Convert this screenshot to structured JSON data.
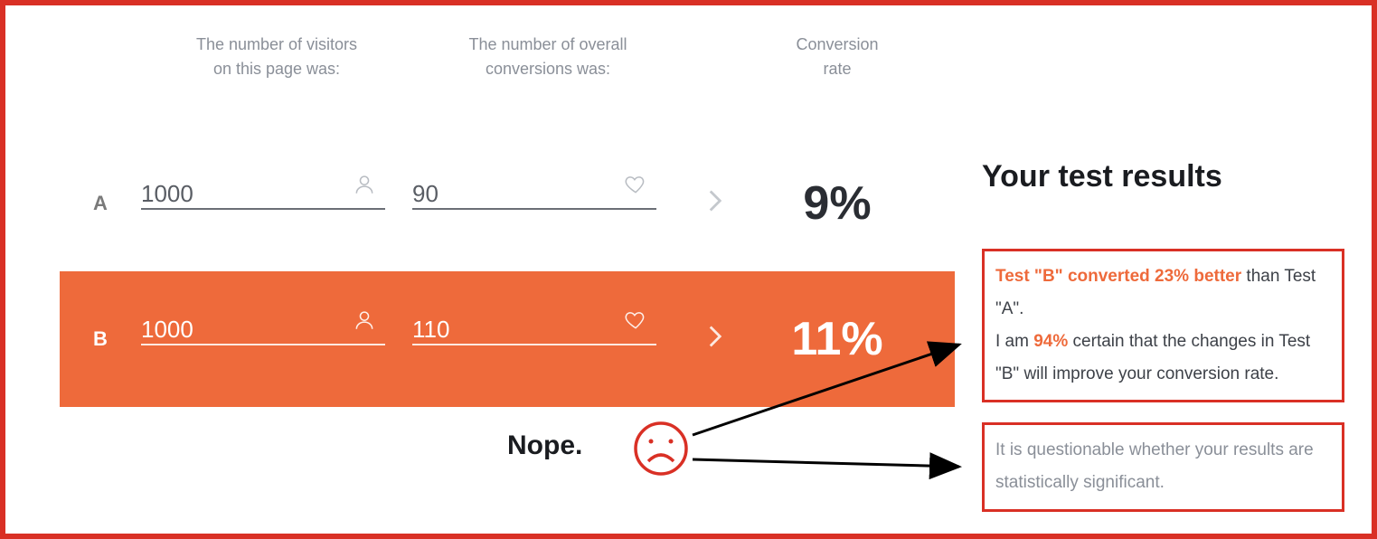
{
  "headers": {
    "visitors_l1": "The number of visitors",
    "visitors_l2": "on this page was:",
    "conversions_l1": "The number of overall",
    "conversions_l2": "conversions was:",
    "rate_l1": "Conversion",
    "rate_l2": "rate"
  },
  "rows": {
    "a": {
      "label": "A",
      "visitors": "1000",
      "conversions": "90",
      "rate": "9%"
    },
    "b": {
      "label": "B",
      "visitors": "1000",
      "conversions": "110",
      "rate": "11%"
    }
  },
  "results": {
    "title": "Your test results",
    "line1_hl": "Test \"B\" converted 23% better",
    "line1_rest": " than Test \"A\".",
    "line2_pre": "I am ",
    "line2_hl": "94%",
    "line2_post": " certain that the changes in Test \"B\" will improve your conversion rate.",
    "line3": "It is questionable whether your results are statistically significant."
  },
  "annotation": {
    "nope": "Nope."
  }
}
